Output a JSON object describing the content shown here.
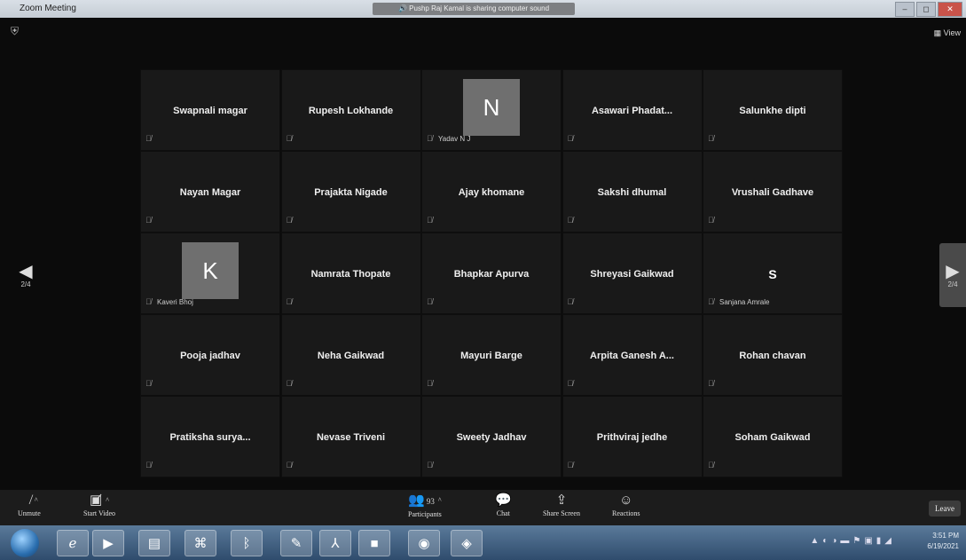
{
  "window": {
    "title": "Zoom Meeting",
    "notice": "Pushp Raj Kamal is sharing computer sound",
    "view_label": "View"
  },
  "navigation": {
    "left_page": "2/4",
    "right_page": "2/4"
  },
  "participants_grid": [
    {
      "name": "Swapnali magar",
      "small_label": ""
    },
    {
      "name": "Rupesh Lokhande",
      "small_label": ""
    },
    {
      "name": "",
      "avatar_letter": "N",
      "small_label": "Yadav N J"
    },
    {
      "name": "Asawari Phadat...",
      "small_label": ""
    },
    {
      "name": "Salunkhe dipti",
      "small_label": ""
    },
    {
      "name": "Nayan Magar",
      "small_label": ""
    },
    {
      "name": "Prajakta Nigade",
      "small_label": ""
    },
    {
      "name": "Ajay khomane",
      "small_label": ""
    },
    {
      "name": "Sakshi dhumal",
      "small_label": ""
    },
    {
      "name": "Vrushali Gadhave",
      "small_label": ""
    },
    {
      "name": "",
      "avatar_letter": "K",
      "small_label": "Kaveri Bhoj"
    },
    {
      "name": "Namrata Thopate",
      "small_label": ""
    },
    {
      "name": "Bhapkar Apurva",
      "small_label": ""
    },
    {
      "name": "Shreyasi Gaikwad",
      "small_label": ""
    },
    {
      "name": "",
      "big_letter": "S",
      "small_label": "Sanjana Amrale"
    },
    {
      "name": "Pooja jadhav",
      "small_label": ""
    },
    {
      "name": "Neha Gaikwad",
      "small_label": ""
    },
    {
      "name": "Mayuri Barge",
      "small_label": ""
    },
    {
      "name": "Arpita Ganesh A...",
      "small_label": ""
    },
    {
      "name": "Rohan chavan",
      "small_label": ""
    },
    {
      "name": "Pratiksha surya...",
      "small_label": ""
    },
    {
      "name": "Nevase Triveni",
      "small_label": ""
    },
    {
      "name": "Sweety Jadhav",
      "small_label": ""
    },
    {
      "name": "Prithviraj jedhe",
      "small_label": ""
    },
    {
      "name": "Soham Gaikwad",
      "small_label": ""
    }
  ],
  "toolbar": {
    "unmute": "Unmute",
    "start_video": "Start Video",
    "participants": "Participants",
    "participants_count": "93",
    "chat": "Chat",
    "share_screen": "Share Screen",
    "reactions": "Reactions",
    "leave": "Leave"
  },
  "taskbar": {
    "time": "3:51 PM",
    "date": "6/19/2021"
  }
}
